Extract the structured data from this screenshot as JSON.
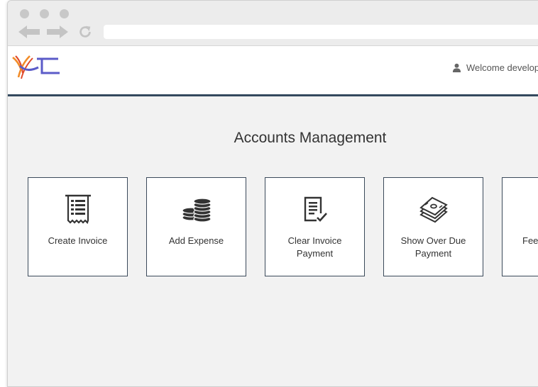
{
  "browser": {
    "address_value": ""
  },
  "header": {
    "welcome_text": "Welcome developer"
  },
  "main": {
    "title": "Accounts Management",
    "cards": [
      {
        "label": "Create Invoice",
        "icon": "receipt-icon"
      },
      {
        "label": "Add Expense",
        "icon": "coins-stack-icon"
      },
      {
        "label": "Clear Invoice Payment",
        "icon": "document-check-icon"
      },
      {
        "label": "Show Over Due Payment",
        "icon": "money-stack-icon"
      },
      {
        "label": "Fee",
        "icon": "unknown-icon"
      }
    ]
  },
  "colors": {
    "accent_navy": "#34495e",
    "logo_blue": "#5b5bc8",
    "logo_orange": "#f28c28",
    "logo_red": "#e04a2a",
    "icon_dark": "#333333",
    "background": "#f2f2f2"
  }
}
